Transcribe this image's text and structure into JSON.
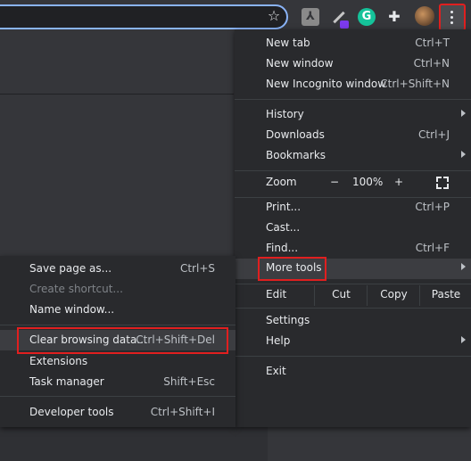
{
  "toolbar": {
    "extensions": [
      {
        "name": "pdf-extension",
        "glyph": "⅄"
      },
      {
        "name": "pen-extension"
      },
      {
        "name": "grammarly-extension",
        "glyph": "G"
      },
      {
        "name": "extensions-puzzle",
        "glyph": "✚"
      }
    ],
    "star_glyph": "☆"
  },
  "main_menu": {
    "new_tab": {
      "label": "New tab",
      "shortcut": "Ctrl+T"
    },
    "new_window": {
      "label": "New window",
      "shortcut": "Ctrl+N"
    },
    "new_incognito": {
      "label": "New Incognito window",
      "shortcut": "Ctrl+Shift+N"
    },
    "history": {
      "label": "History"
    },
    "downloads": {
      "label": "Downloads",
      "shortcut": "Ctrl+J"
    },
    "bookmarks": {
      "label": "Bookmarks"
    },
    "zoom": {
      "label": "Zoom",
      "minus": "−",
      "value": "100%",
      "plus": "+"
    },
    "print": {
      "label": "Print...",
      "shortcut": "Ctrl+P"
    },
    "cast": {
      "label": "Cast..."
    },
    "find": {
      "label": "Find...",
      "shortcut": "Ctrl+F"
    },
    "more_tools": {
      "label": "More tools"
    },
    "edit": {
      "label": "Edit",
      "cut": "Cut",
      "copy": "Copy",
      "paste": "Paste"
    },
    "settings": {
      "label": "Settings"
    },
    "help": {
      "label": "Help"
    },
    "exit": {
      "label": "Exit"
    }
  },
  "sub_menu": {
    "save_page": {
      "label": "Save page as...",
      "shortcut": "Ctrl+S"
    },
    "create_shortcut": {
      "label": "Create shortcut..."
    },
    "name_window": {
      "label": "Name window..."
    },
    "clear_data": {
      "label": "Clear browsing data...",
      "shortcut": "Ctrl+Shift+Del"
    },
    "extensions": {
      "label": "Extensions"
    },
    "task_manager": {
      "label": "Task manager",
      "shortcut": "Shift+Esc"
    },
    "dev_tools": {
      "label": "Developer tools",
      "shortcut": "Ctrl+Shift+I"
    }
  },
  "colors": {
    "highlight_box": "#e01f1f",
    "menu_bg": "#292a2d",
    "toolbar_bg": "#35363a",
    "omnibox_border": "#8ab4f8"
  }
}
